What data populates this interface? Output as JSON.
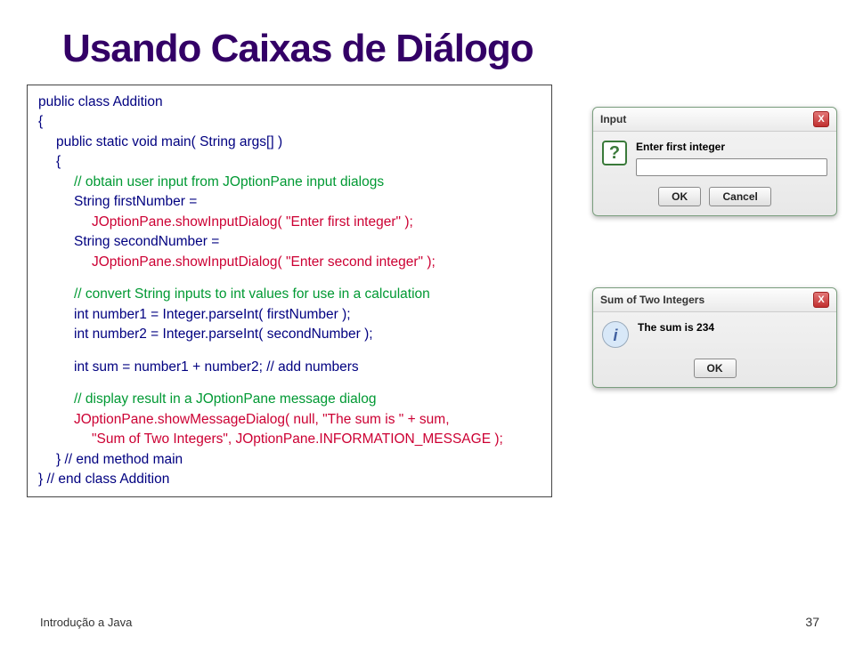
{
  "title": "Usando Caixas de Diálogo",
  "code": {
    "l1": "public class Addition",
    "l2": "{",
    "l3": "public static void main( String args[] )",
    "l4": "{",
    "l5": "// obtain user input from JOptionPane input dialogs",
    "l6": "String firstNumber =",
    "l7": "JOptionPane.showInputDialog( \"Enter first integer\" );",
    "l8": "String secondNumber =",
    "l9": "JOptionPane.showInputDialog( \"Enter second integer\" );",
    "l10": "// convert String inputs to int values for use in a calculation",
    "l11": "int number1 = Integer.parseInt( firstNumber );",
    "l12": "int number2 = Integer.parseInt( secondNumber );",
    "l13": "int sum = number1 + number2; // add numbers",
    "l14": "// display result in a JOptionPane message dialog",
    "l15": "JOptionPane.showMessageDialog( null, \"The sum is \" + sum,",
    "l16": "\"Sum of Two Integers\", JOptionPane.INFORMATION_MESSAGE );",
    "l17": "} // end method main",
    "l18": "} // end class Addition"
  },
  "dialog1": {
    "title": "Input",
    "prompt": "Enter first integer",
    "ok": "OK",
    "cancel": "Cancel"
  },
  "dialog2": {
    "title": "Sum of Two Integers",
    "message": "The sum is 234",
    "ok": "OK"
  },
  "footer": "Introdução a Java",
  "page": "37",
  "icons": {
    "q": "?",
    "i": "i",
    "x": "X"
  }
}
